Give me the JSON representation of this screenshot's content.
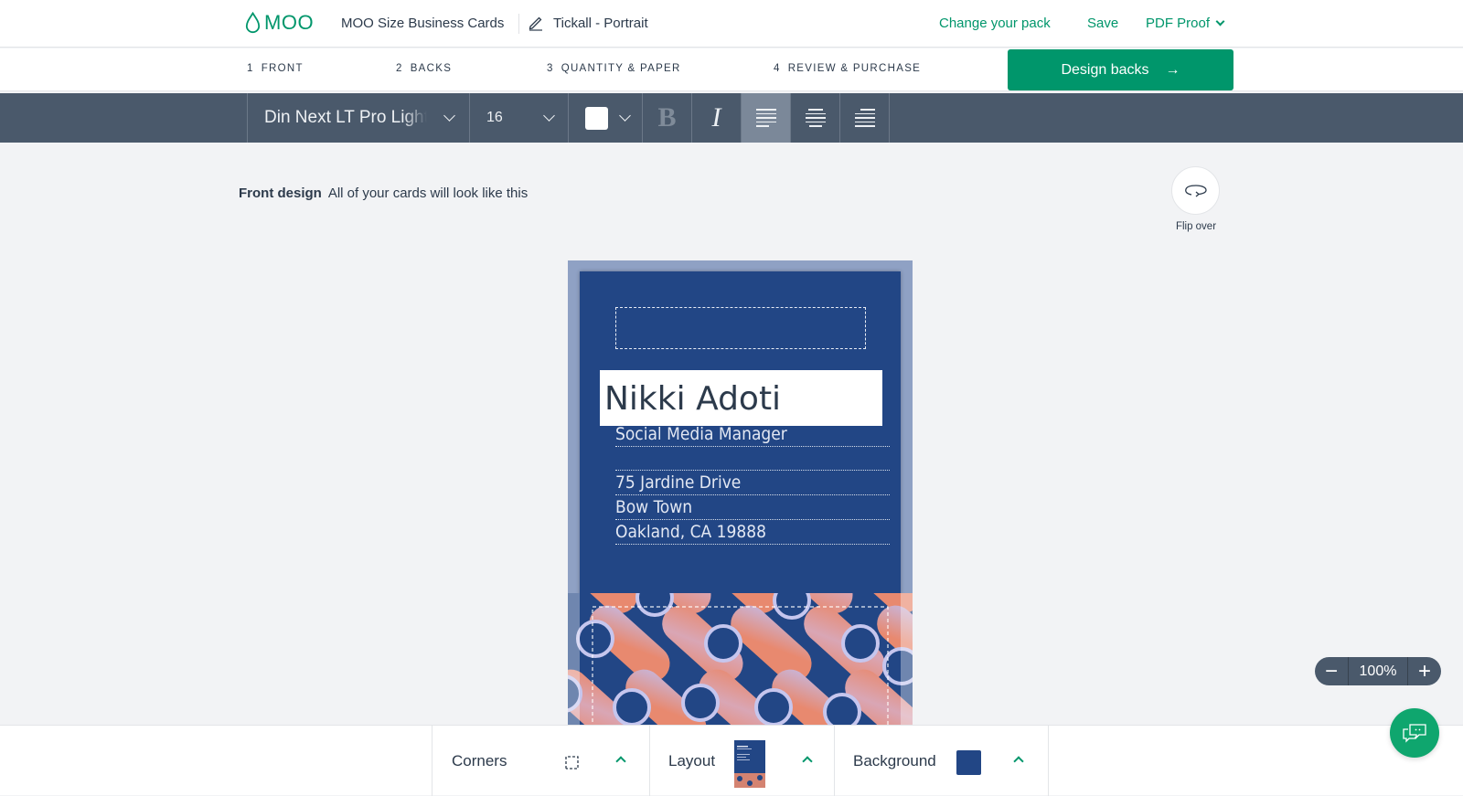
{
  "header": {
    "brand": "MOO",
    "product": "MOO Size Business Cards",
    "design_name": "Tickall - Portrait",
    "links": {
      "change_pack": "Change your pack",
      "save": "Save",
      "pdf_proof": "PDF Proof"
    }
  },
  "steps": [
    {
      "num": "1",
      "label": "FRONT"
    },
    {
      "num": "2",
      "label": "BACKS"
    },
    {
      "num": "3",
      "label": "QUANTITY & PAPER"
    },
    {
      "num": "4",
      "label": "REVIEW & PURCHASE"
    }
  ],
  "cta": {
    "label": "Design backs",
    "arrow": "→"
  },
  "toolbar": {
    "font": "Din Next LT Pro Light",
    "size": "16",
    "text_color": "#ffffff",
    "bold": "B",
    "italic": "I"
  },
  "caption": {
    "title": "Front design",
    "subtitle": "All of your cards will look like this"
  },
  "flip": {
    "label": "Flip over"
  },
  "card": {
    "name": "Nikki Adoti",
    "title": "Social Media Manager",
    "blank_line": "",
    "address_lines": [
      "75 Jardine Drive",
      "Bow Town",
      "Oakland, CA 19888"
    ],
    "colors": {
      "background": "#224685",
      "accent_peach": "#e8896f",
      "accent_lilac": "#c6b9e2"
    }
  },
  "bottom": {
    "corners": "Corners",
    "layout": "Layout",
    "background": "Background",
    "background_color": "#224685"
  },
  "zoom": {
    "value": "100%",
    "minus": "−",
    "plus": "+"
  },
  "colors": {
    "brand_green": "#00966b",
    "toolbar": "#4a596b"
  }
}
